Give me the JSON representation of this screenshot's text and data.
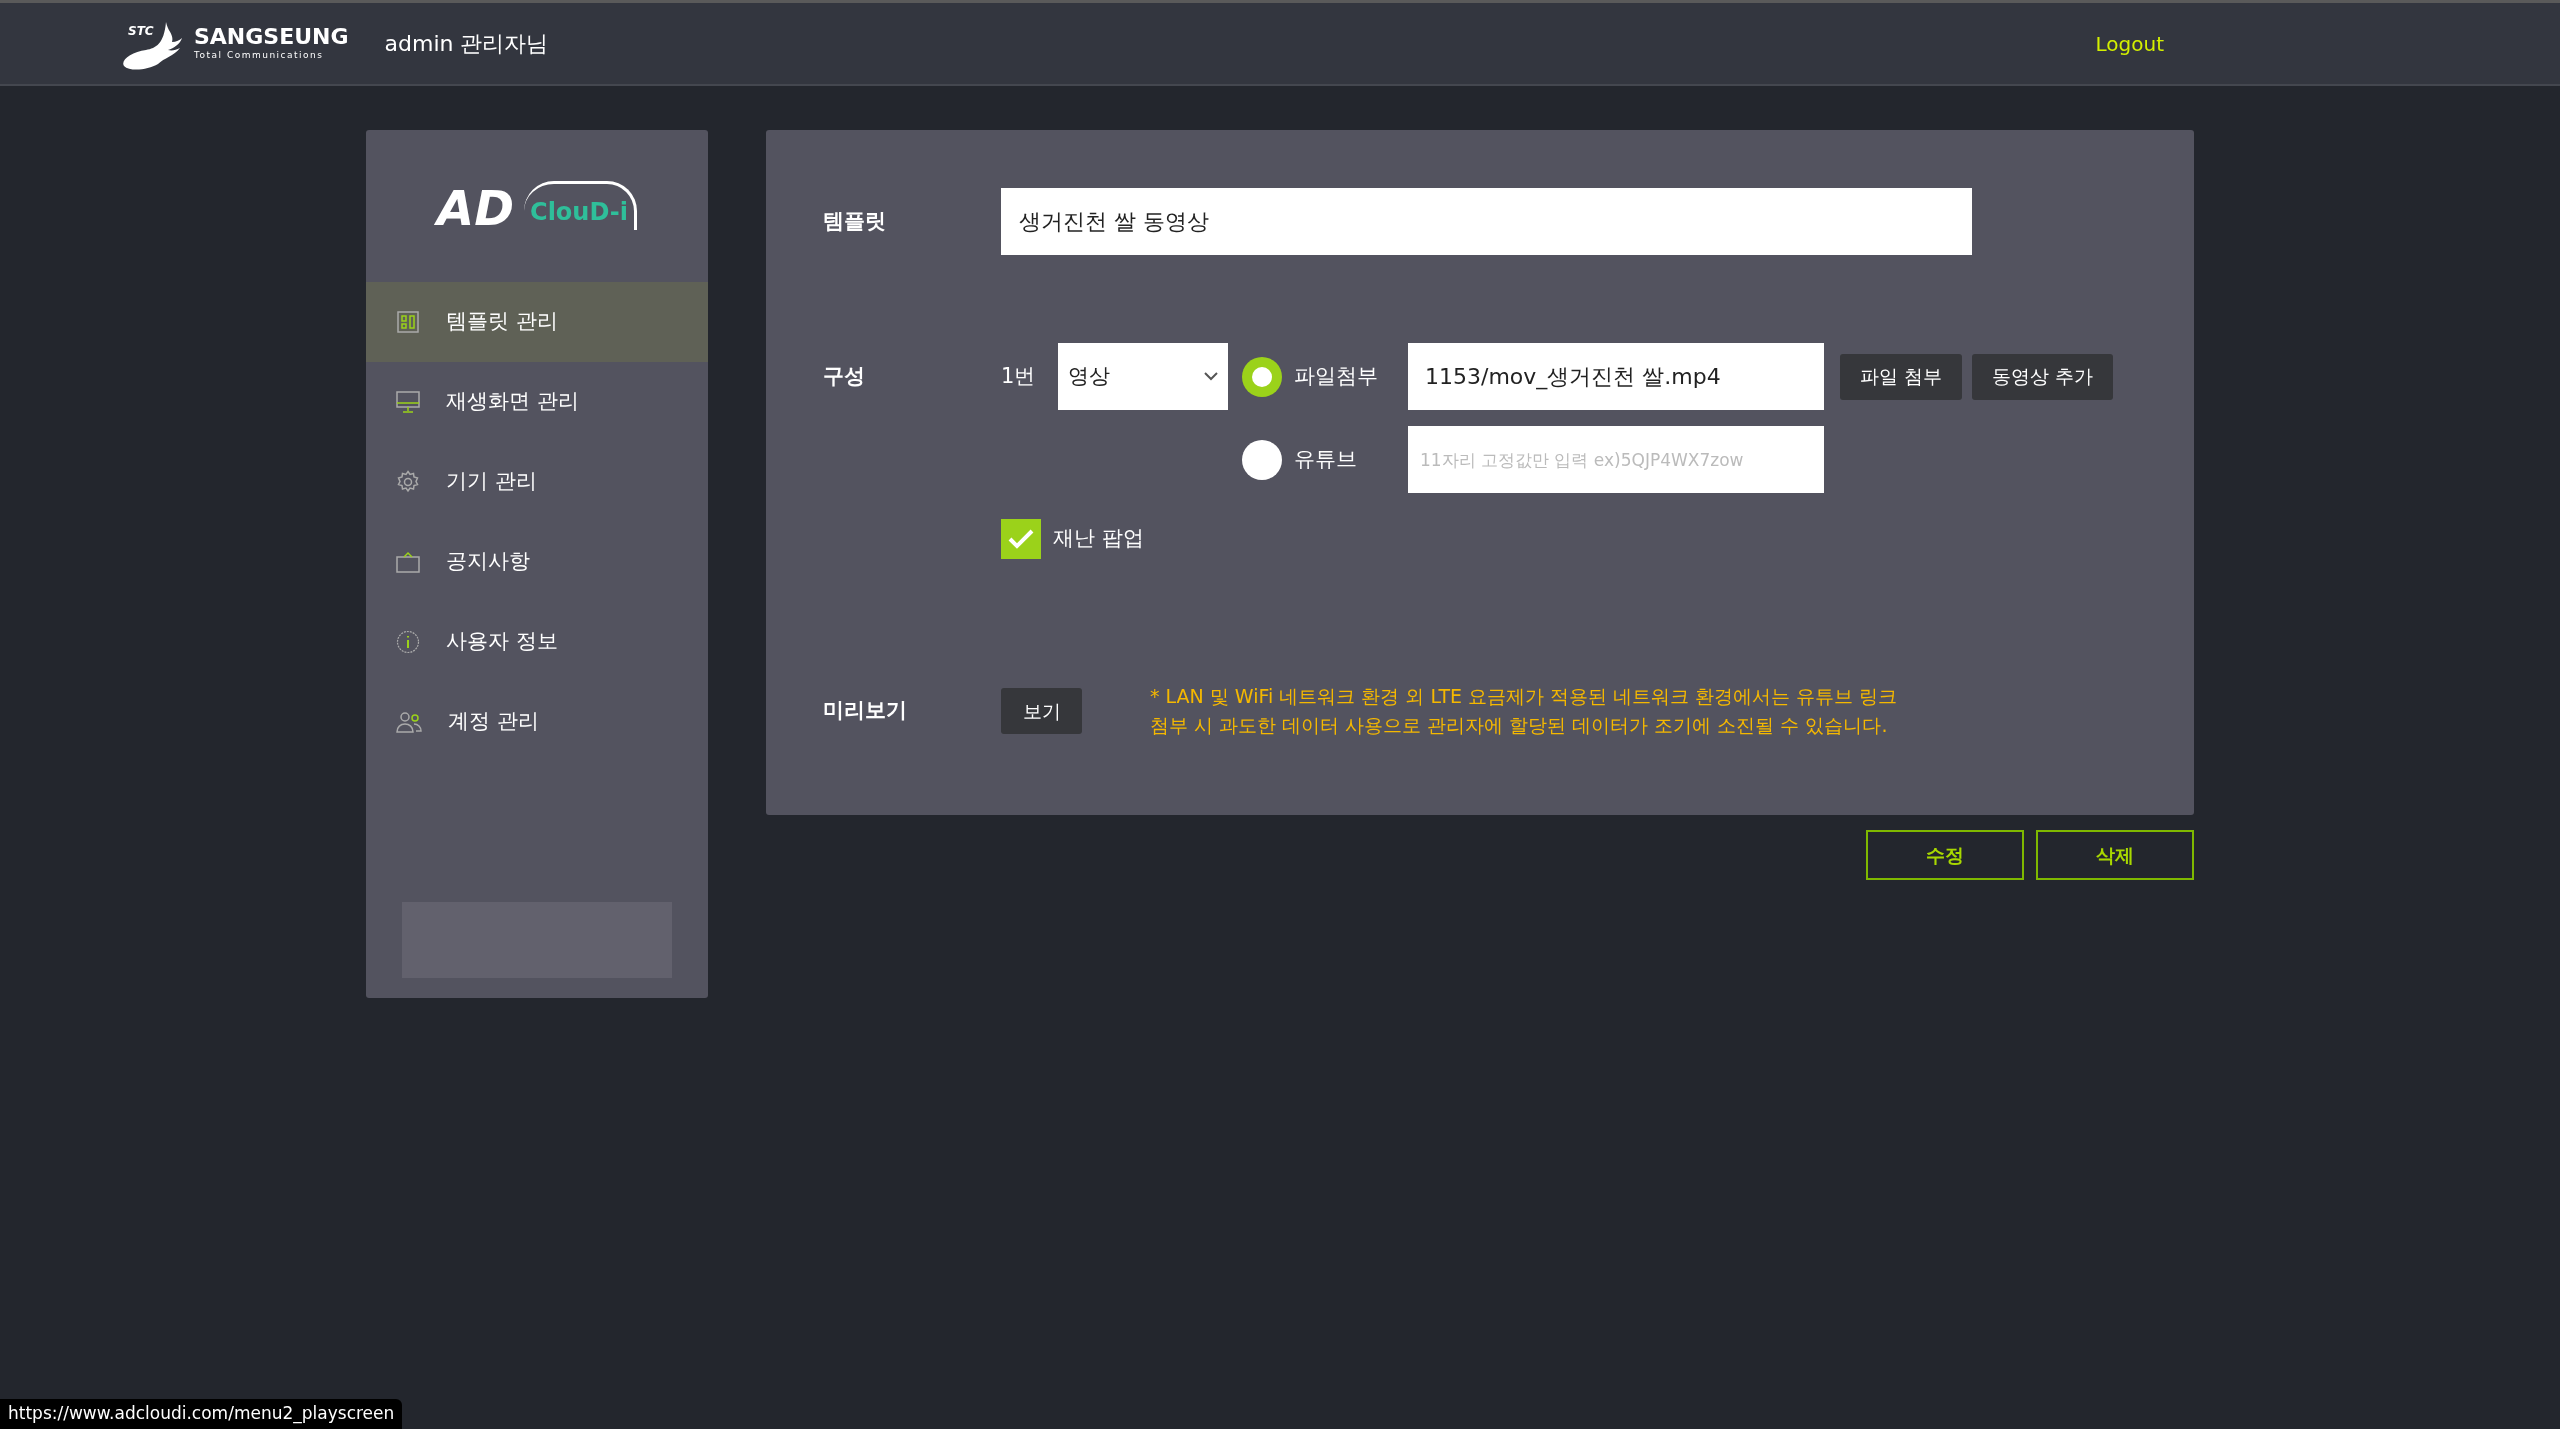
{
  "header": {
    "logo": {
      "mark": "STC",
      "name": "SANGSEUNG",
      "tagline": "Total Communications"
    },
    "user": "admin 관리자님",
    "logout": "Logout"
  },
  "sidebar": {
    "logo": {
      "main": "AD",
      "sub": "ClouD-i"
    },
    "items": [
      {
        "label": "템플릿 관리",
        "selected": true
      },
      {
        "label": "재생화면 관리",
        "selected": false
      },
      {
        "label": "기기 관리",
        "selected": false
      },
      {
        "label": "공지사항",
        "selected": false
      },
      {
        "label": "사용자 정보",
        "selected": false
      },
      {
        "label": "계정 관리",
        "selected": false
      }
    ]
  },
  "form": {
    "template": {
      "label": "템플릿",
      "value": "생거진천 쌀 동영상"
    },
    "composition": {
      "label": "구성",
      "index": "1번",
      "type_select": "영상",
      "sources": [
        {
          "label": "파일첨부",
          "selected": true,
          "value": "1153/mov_생거진천 쌀.mp4"
        },
        {
          "label": "유튜브",
          "selected": false,
          "placeholder": "11자리 고정값만 입력 ex)5QJP4WX7zow"
        }
      ],
      "buttons": [
        "파일 첨부",
        "동영상 추가"
      ],
      "disaster_popup": {
        "label": "재난 팝업",
        "checked": true
      }
    },
    "preview": {
      "label": "미리보기",
      "button": "보기",
      "notice": [
        "* LAN 및 WiFi 네트워크 환경 외 LTE 요금제가 적용된 네트워크 환경에서는 유튜브 링크",
        "첨부 시 과도한 데이터 사용으로 관리자에 할당된 데이터가 조기에 소진될 수 있습니다."
      ]
    }
  },
  "actions": [
    "수정",
    "삭제"
  ],
  "status_url": "https://www.adcloudi.com/menu2_playscreen"
}
